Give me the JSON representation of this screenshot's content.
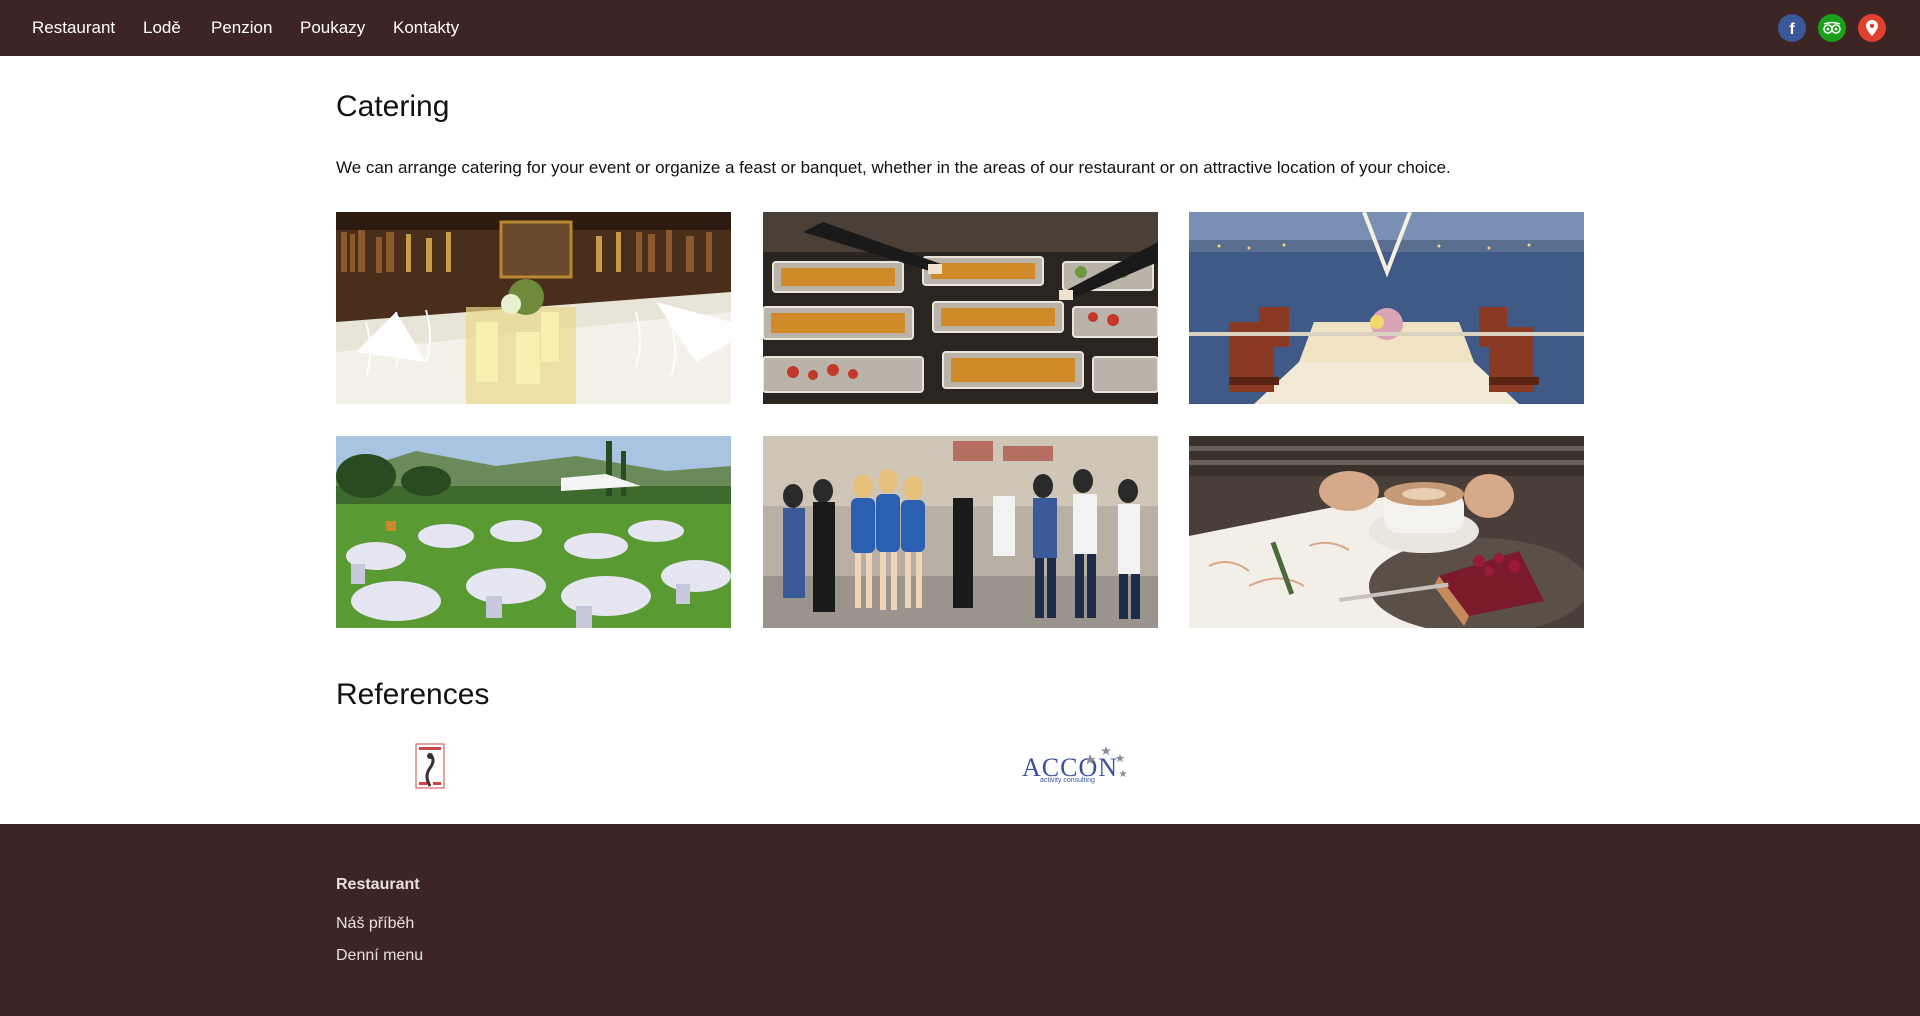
{
  "nav": {
    "items": [
      {
        "label": "Restaurant"
      },
      {
        "label": "Lodě"
      },
      {
        "label": "Penzion"
      },
      {
        "label": "Poukazy"
      },
      {
        "label": "Kontakty"
      }
    ],
    "social": [
      {
        "icon": "facebook-icon",
        "color": "#3b5998"
      },
      {
        "icon": "tripadvisor-icon",
        "color": "#1aa01a"
      },
      {
        "icon": "map-pin-icon",
        "color": "#e0402f"
      }
    ]
  },
  "catering": {
    "title": "Catering",
    "intro": "We can arrange catering for your event or organize a feast or banquet, whether in the areas of our restaurant or on attractive location of your choice."
  },
  "references": {
    "title": "References",
    "logos": [
      {
        "name": "emblem-logo"
      },
      {
        "name": "accon-logo",
        "text": "ACCON",
        "subtext": "activity consulting"
      }
    ]
  },
  "footer": {
    "heading": "Restaurant",
    "links": [
      {
        "label": "Náš příběh"
      },
      {
        "label": "Denní menu"
      }
    ]
  },
  "colors": {
    "brand_dark": "#3d2523",
    "footer_text": "#e8e0dc"
  }
}
